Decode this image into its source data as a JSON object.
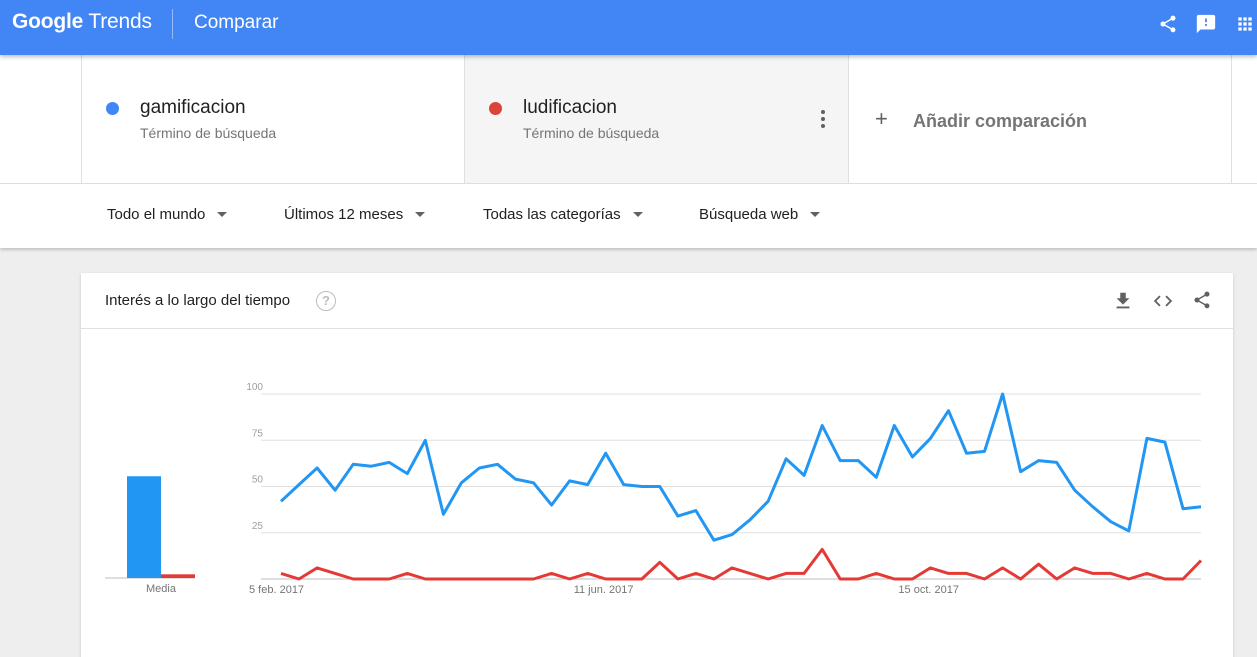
{
  "header": {
    "logo_google": "Google",
    "logo_trends": "Trends",
    "title": "Comparar",
    "icons": [
      "share-icon",
      "feedback-icon",
      "apps-icon"
    ],
    "color": "#4285f4"
  },
  "terms": [
    {
      "name": "gamificacion",
      "type": "Término de búsqueda",
      "color": "#4285f4"
    },
    {
      "name": "ludificacion",
      "type": "Término de búsqueda",
      "color": "#db4437"
    }
  ],
  "add_comparison": {
    "plus": "+",
    "label": "Añadir comparación"
  },
  "filters": {
    "region": "Todo el mundo",
    "time": "Últimos 12 meses",
    "category": "Todas las categorías",
    "search_type": "Búsqueda web"
  },
  "card": {
    "title": "Interés a lo largo del tiempo",
    "help": "?",
    "icons": [
      "download-icon",
      "embed-icon",
      "share-icon"
    ]
  },
  "chart_data": [
    {
      "type": "bar",
      "categories": [
        "Media"
      ],
      "series": [
        {
          "name": "gamificacion",
          "values": [
            55
          ],
          "color": "#2196f3"
        },
        {
          "name": "ludificacion",
          "values": [
            2
          ],
          "color": "#e53935"
        }
      ],
      "ylim": [
        0,
        100
      ]
    },
    {
      "type": "line",
      "x_tick_labels": [
        "5 feb. 2017",
        "11 jun. 2017",
        "15 oct. 2017"
      ],
      "x_tick_index": [
        0,
        18,
        36
      ],
      "y_ticks": [
        25,
        50,
        75,
        100
      ],
      "ylim": [
        0,
        100
      ],
      "grid": true,
      "series": [
        {
          "name": "gamificacion",
          "color": "#2196f3",
          "values": [
            42,
            51,
            60,
            48,
            62,
            61,
            63,
            57,
            75,
            35,
            52,
            60,
            62,
            54,
            52,
            40,
            53,
            51,
            68,
            51,
            50,
            50,
            34,
            37,
            21,
            24,
            32,
            42,
            65,
            56,
            83,
            64,
            64,
            55,
            83,
            66,
            76,
            91,
            68,
            69,
            100,
            58,
            64,
            63,
            48,
            39,
            31,
            26,
            76,
            74,
            38,
            39
          ]
        },
        {
          "name": "ludificacion",
          "color": "#e53935",
          "values": [
            3,
            0,
            6,
            3,
            0,
            0,
            0,
            3,
            0,
            0,
            0,
            0,
            0,
            0,
            0,
            3,
            0,
            3,
            0,
            0,
            0,
            9,
            0,
            3,
            0,
            6,
            3,
            0,
            3,
            3,
            16,
            0,
            0,
            3,
            0,
            0,
            6,
            3,
            3,
            0,
            6,
            0,
            8,
            0,
            6,
            3,
            3,
            0,
            3,
            0,
            0,
            10
          ]
        }
      ]
    }
  ]
}
